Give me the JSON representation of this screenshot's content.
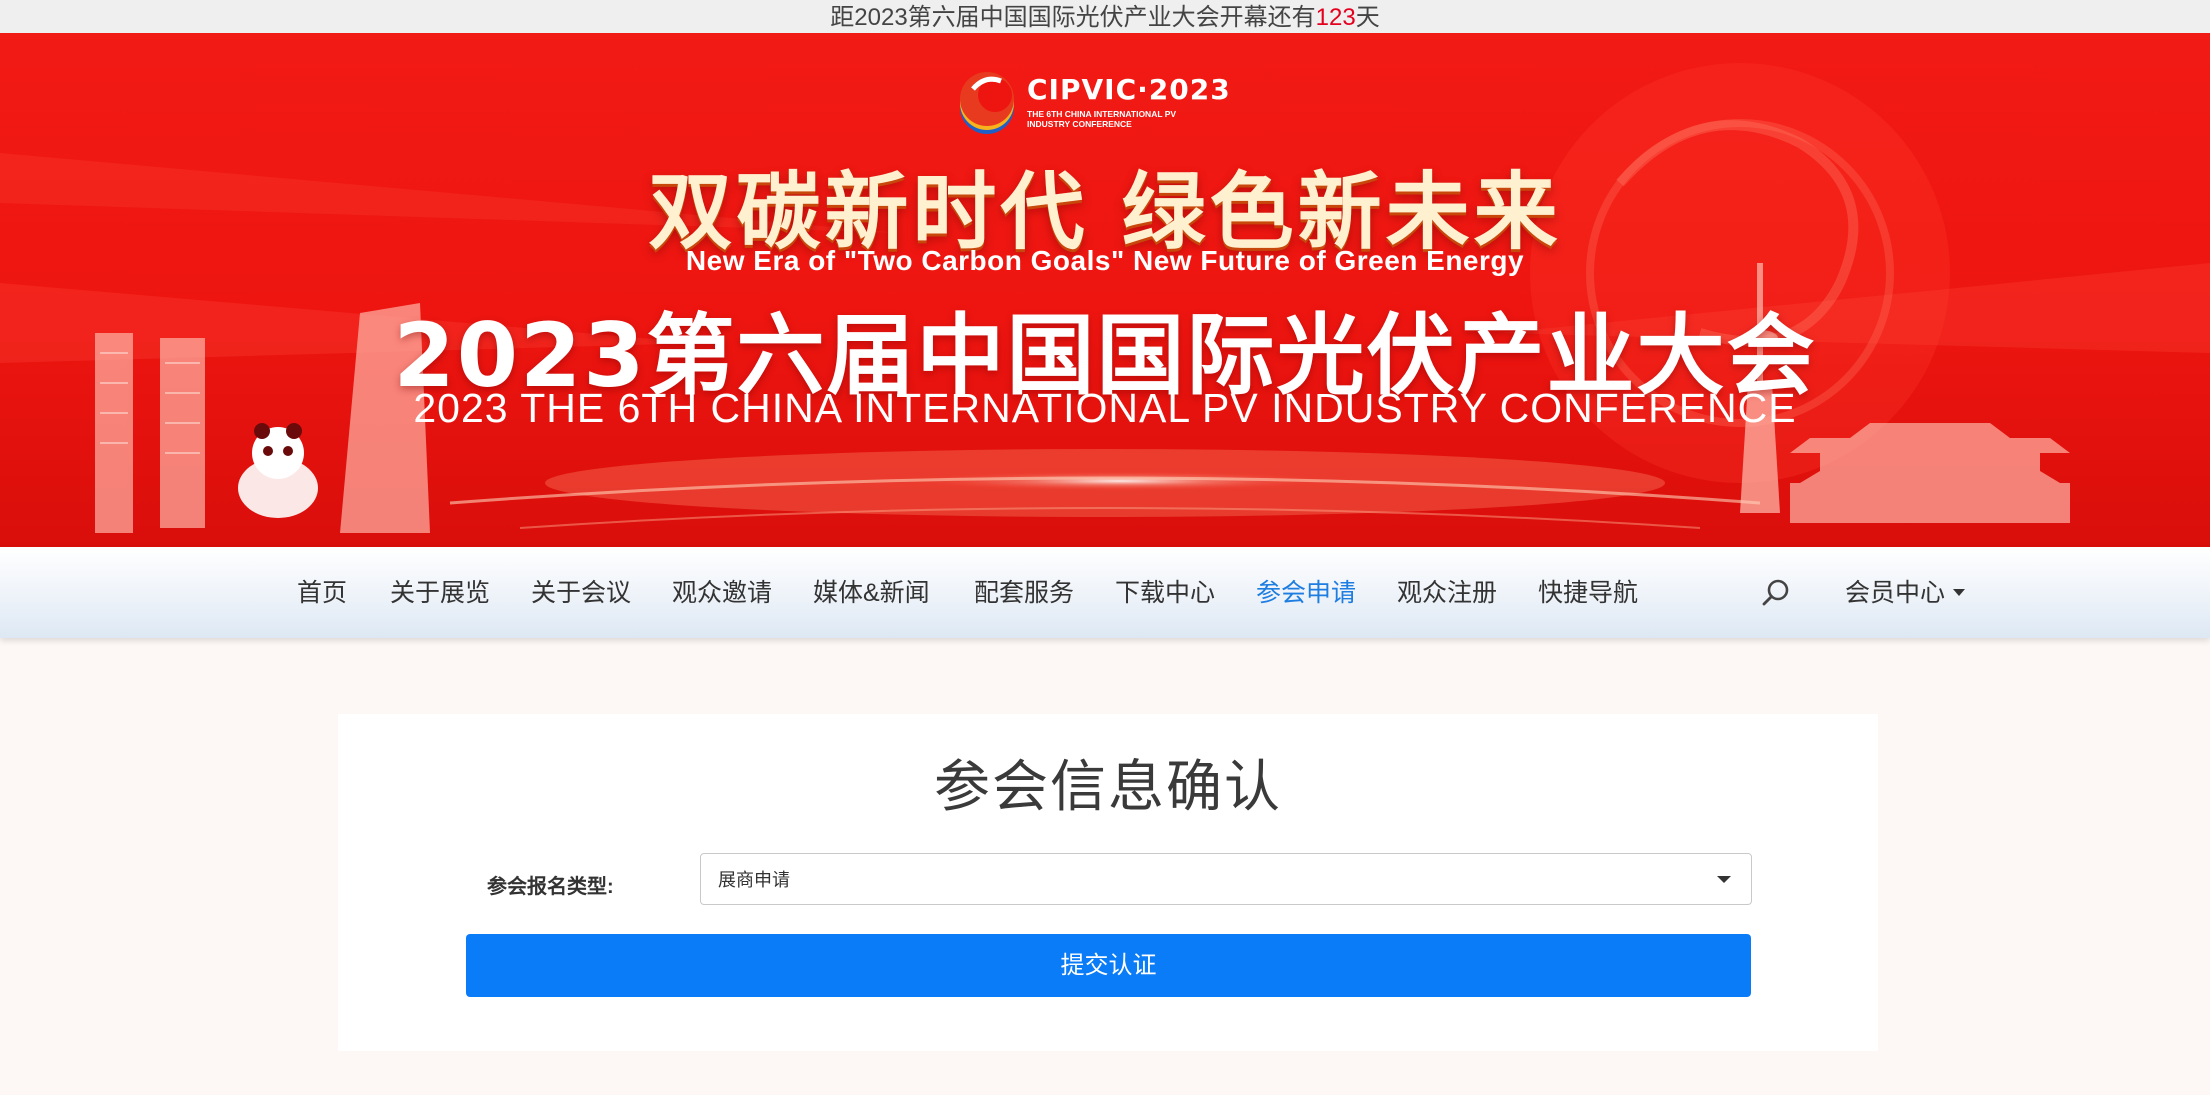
{
  "countdown": {
    "prefix": "距2023第六届中国国际光伏产业大会开幕还有",
    "days": "123",
    "suffix": "天"
  },
  "banner": {
    "logo_text": "CIPVIC·2023",
    "logo_sub": "THE 6TH CHINA INTERNATIONAL PV INDUSTRY CONFERENCE",
    "slogan_cn": "双碳新时代  绿色新未来",
    "slogan_en": "New Era of \"Two Carbon Goals\"  New Future of Green Energy",
    "title_cn": "2023第六届中国国际光伏产业大会",
    "title_en": "2023 THE 6TH CHINA INTERNATIONAL PV INDUSTRY CONFERENCE"
  },
  "nav": {
    "items": [
      "首页",
      "关于展览",
      "关于会议",
      "观众邀请",
      "媒体&新闻",
      "配套服务",
      "下载中心",
      "参会申请",
      "观众注册",
      "快捷导航"
    ],
    "active": "参会申请",
    "member": "会员中心"
  },
  "form": {
    "title": "参会信息确认",
    "type_label": "参会报名类型:",
    "type_value": "展商申请",
    "submit_label": "提交认证"
  },
  "colors": {
    "banner_red": "#ee1510",
    "nav_active": "#1e7de0",
    "submit_blue": "#0a7cf7",
    "countdown_highlight": "#e4001e"
  }
}
